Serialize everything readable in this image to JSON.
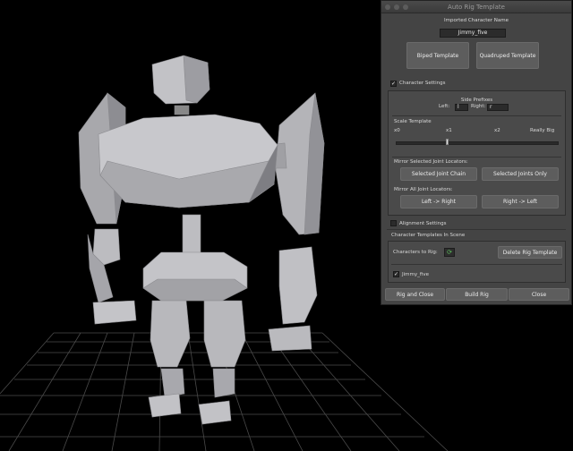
{
  "window": {
    "title": "Auto Rig Template"
  },
  "character": {
    "label": "Imported Character Name",
    "name": "Jimmy_five",
    "biped_button": "Biped Template",
    "quadruped_button": "Quadruped Template"
  },
  "settings": {
    "header": "Character Settings",
    "checked": true,
    "side_prefixes_label": "Side Prefixes",
    "left_label": "Left:",
    "left_value": "l",
    "right_label": "Right:",
    "right_value": "r",
    "scale_label": "Scale Template",
    "scale_ticks": [
      "x0",
      "x1",
      "x2",
      "Really Big"
    ],
    "scale_value": 1,
    "mirror_selected_label": "Mirror Selected Joint Locators:",
    "selected_joint_chain": "Selected Joint Chain",
    "selected_joints_only": "Selected Joints Only",
    "mirror_all_label": "Mirror All Joint Locators:",
    "left_to_right": "Left -> Right",
    "right_to_left": "Right -> Left"
  },
  "alignment": {
    "header": "Alignment Settings",
    "checked": false
  },
  "templates": {
    "header": "Character Templates In Scene",
    "characters_label": "Characters to Rig:",
    "delete_button": "Delete Rig Template",
    "items": [
      {
        "name": "Jimmy_five",
        "checked": true
      }
    ]
  },
  "footer": {
    "rig_and_close": "Rig and Close",
    "build_rig": "Build Rig",
    "close": "Close"
  },
  "viewport": {
    "background": "#000000",
    "grid_color": "#4a4a4a",
    "mesh_color": "#b4b4b8"
  }
}
